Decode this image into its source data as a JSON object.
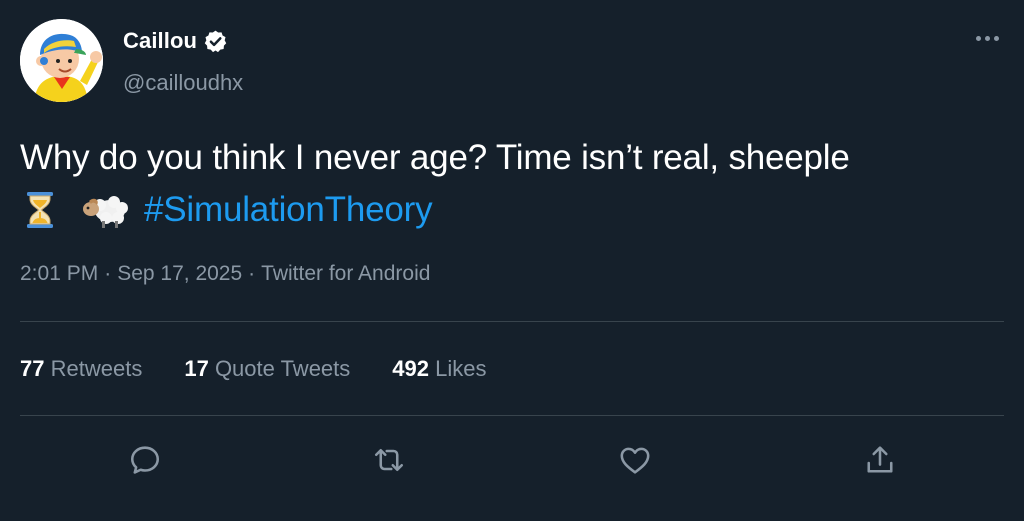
{
  "tweet": {
    "author": {
      "display_name": "Caillou",
      "handle": "@cailloudhx",
      "verified": true,
      "avatar_icon": "caillou-avatar"
    },
    "text_line1": "Why do you think I never age? Time isn’t real, sheeple",
    "emojis": [
      "hourglass-icon",
      "sheep-icon"
    ],
    "hashtag": "#SimulationTheory",
    "time": "2:01 PM",
    "date": "Sep 17, 2025",
    "source": "Twitter for Android",
    "separator": "·"
  },
  "stats": {
    "retweets_count": "77",
    "retweets_label": "Retweets",
    "quotes_count": "17",
    "quotes_label": "Quote Tweets",
    "likes_count": "492",
    "likes_label": "Likes"
  },
  "actions": [
    "reply-icon",
    "retweet-icon",
    "like-icon",
    "share-icon"
  ],
  "colors": {
    "background": "#15202b",
    "secondary_text": "#8b98a5",
    "link": "#1d9bf0",
    "divider": "#38444d"
  }
}
